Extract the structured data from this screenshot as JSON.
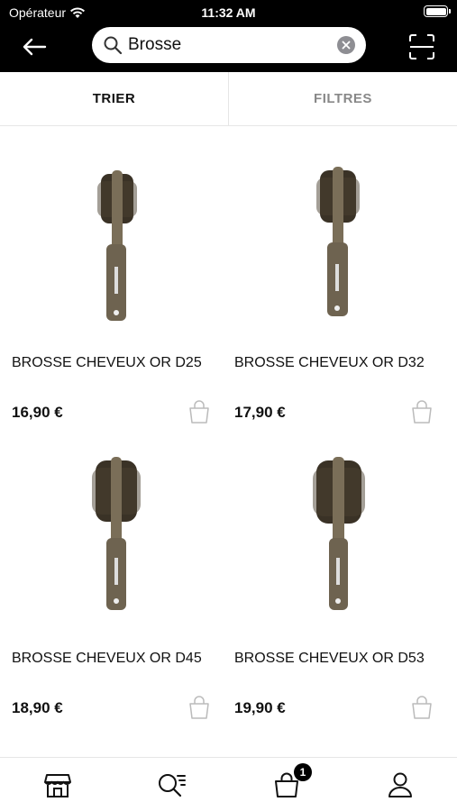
{
  "status_bar": {
    "carrier": "Opérateur",
    "time": "11:32 AM"
  },
  "search": {
    "value": "Brosse",
    "placeholder": ""
  },
  "tabs": {
    "sort_label": "TRIER",
    "filter_label": "FILTRES"
  },
  "products": [
    {
      "name": "BROSSE CHEVEUX OR D25",
      "price": "16,90 €"
    },
    {
      "name": "BROSSE CHEVEUX OR D32",
      "price": "17,90 €"
    },
    {
      "name": "BROSSE CHEVEUX OR D45",
      "price": "18,90 €"
    },
    {
      "name": "BROSSE CHEVEUX OR D53",
      "price": "19,90 €"
    }
  ],
  "bottom_nav": {
    "cart_badge": "1",
    "icons": [
      "store-icon",
      "search-list-icon",
      "shopping-bag-icon",
      "user-icon"
    ]
  },
  "colors": {
    "header_bg": "#000000",
    "brush_handle": "#6e6350",
    "brush_bristles": "#3a3226",
    "muted_text": "#888888"
  }
}
